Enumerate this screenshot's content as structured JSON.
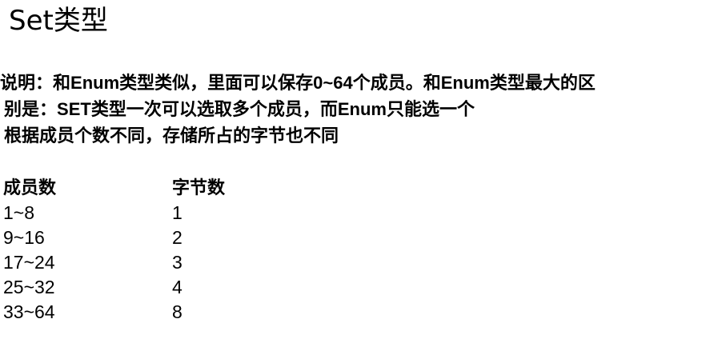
{
  "slide": {
    "title": "Set类型",
    "description": {
      "line1": {
        "p1": "说明：和",
        "p2": "Enum",
        "p3": "类型类似，里面可以保存",
        "p4": "0~64",
        "p5": "个成员。和",
        "p6": "Enum",
        "p7": "类型最大的区"
      },
      "line2": {
        "p1": "别是：",
        "p2": "SET",
        "p3": "类型一次可以选取多个成员，而",
        "p4": "Enum",
        "p5": "只能选一个"
      },
      "line3": "根据成员个数不同，存储所占的字节也不同"
    },
    "table": {
      "headers": [
        "成员数",
        "字节数"
      ],
      "rows": [
        [
          "1~8",
          "1"
        ],
        [
          "9~16",
          "2"
        ],
        [
          "17~24",
          "3"
        ],
        [
          "25~32",
          "4"
        ],
        [
          "33~64",
          "8"
        ]
      ]
    }
  }
}
